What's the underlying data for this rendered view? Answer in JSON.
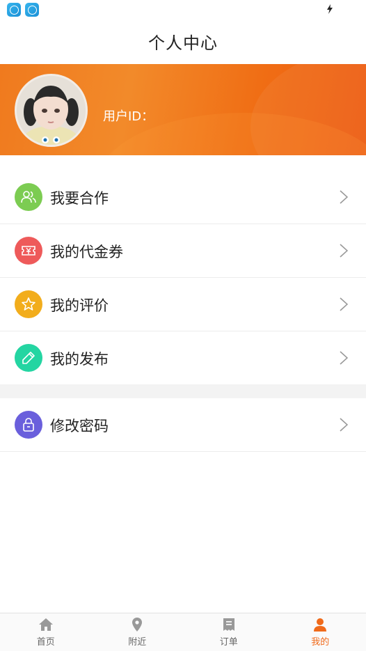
{
  "status_bar": {
    "icons": [
      "app-icon",
      "app-icon",
      "flash-icon"
    ]
  },
  "header": {
    "title": "个人中心"
  },
  "profile": {
    "user_id_label": "用户ID：",
    "avatar": "user-avatar"
  },
  "menu": {
    "group1": [
      {
        "label": "我要合作",
        "icon": "users-icon",
        "color": "#7ccc52"
      },
      {
        "label": "我的代金券",
        "icon": "voucher-icon",
        "color": "#ee5a5a"
      },
      {
        "label": "我的评价",
        "icon": "star-icon",
        "color": "#f2ad1c"
      },
      {
        "label": "我的发布",
        "icon": "pencil-icon",
        "color": "#24d5a2"
      }
    ],
    "group2": [
      {
        "label": "修改密码",
        "icon": "lock-icon",
        "color": "#6a5fdc"
      }
    ]
  },
  "tabs": [
    {
      "label": "首页",
      "icon": "home-icon",
      "active": false
    },
    {
      "label": "附近",
      "icon": "location-icon",
      "active": false
    },
    {
      "label": "订单",
      "icon": "order-icon",
      "active": false
    },
    {
      "label": "我的",
      "icon": "user-icon",
      "active": true
    }
  ],
  "colors": {
    "accent": "#f06a1a",
    "banner": "#f07a1e",
    "inactive_tab": "#999999"
  }
}
